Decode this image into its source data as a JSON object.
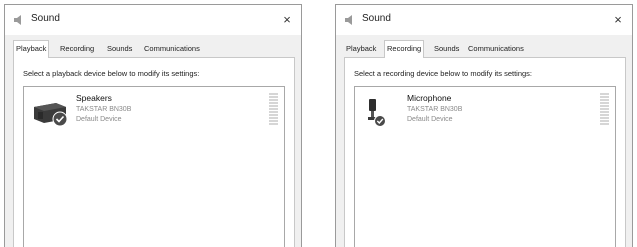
{
  "windows": [
    {
      "title": "Sound",
      "close_glyph": "×",
      "tabs": [
        {
          "label": "Playback",
          "active": true
        },
        {
          "label": "Recording",
          "active": false
        },
        {
          "label": "Sounds",
          "active": false
        },
        {
          "label": "Communications",
          "active": false
        }
      ],
      "instruction": "Select a playback device below to modify its settings:",
      "device": {
        "icon": "speaker-icon",
        "name": "Speakers",
        "model": "TAKSTAR BN30B",
        "status": "Default Device",
        "default_badge": "check-badge-icon"
      }
    },
    {
      "title": "Sound",
      "close_glyph": "×",
      "tabs": [
        {
          "label": "Playback",
          "active": false
        },
        {
          "label": "Recording",
          "active": true
        },
        {
          "label": "Sounds",
          "active": false
        },
        {
          "label": "Communications",
          "active": false
        }
      ],
      "instruction": "Select a recording device below to modify its settings:",
      "device": {
        "icon": "microphone-icon",
        "name": "Microphone",
        "model": "TAKSTAR BN30B",
        "status": "Default Device",
        "default_badge": "check-badge-icon"
      }
    }
  ],
  "colors": {
    "badge": "#4a4a4a",
    "device_body": "#2e2e2e",
    "muted_text": "#8a8a8a"
  }
}
